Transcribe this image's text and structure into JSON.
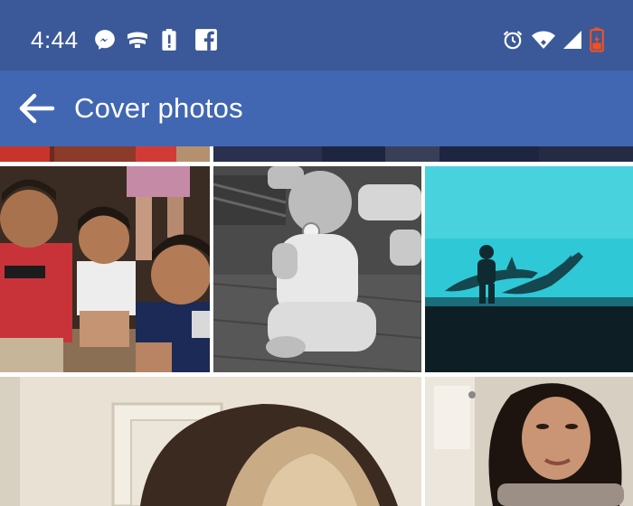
{
  "status_bar": {
    "time": "4:44",
    "notification_icons": [
      "messenger-icon",
      "chat-heads-icon",
      "alert-battery-icon",
      "facebook-icon"
    ],
    "system_icons": [
      "alarm-icon",
      "wifi-icon",
      "cellular-signal-icon",
      "battery-charging-icon"
    ],
    "background_color": "#3b5998"
  },
  "app_bar": {
    "title": "Cover photos",
    "back_icon": "arrow-back-icon",
    "background_color": "#4267b2"
  },
  "photo_grid": {
    "photos": [
      {
        "id": "photo-top-left-partial",
        "subject": "cropped red photo"
      },
      {
        "id": "photo-top-right-partial",
        "subject": "cropped dark photo"
      },
      {
        "id": "photo-three-boys",
        "subject": "three smiling boys"
      },
      {
        "id": "photo-baby-bw",
        "subject": "black and white baby with pacifier"
      },
      {
        "id": "photo-dolphins",
        "subject": "child silhouette with dolphins at aquarium"
      },
      {
        "id": "photo-selfie-partial",
        "subject": "cropped selfie near door"
      },
      {
        "id": "photo-woman-portrait",
        "subject": "woman with curly hair"
      }
    ]
  }
}
